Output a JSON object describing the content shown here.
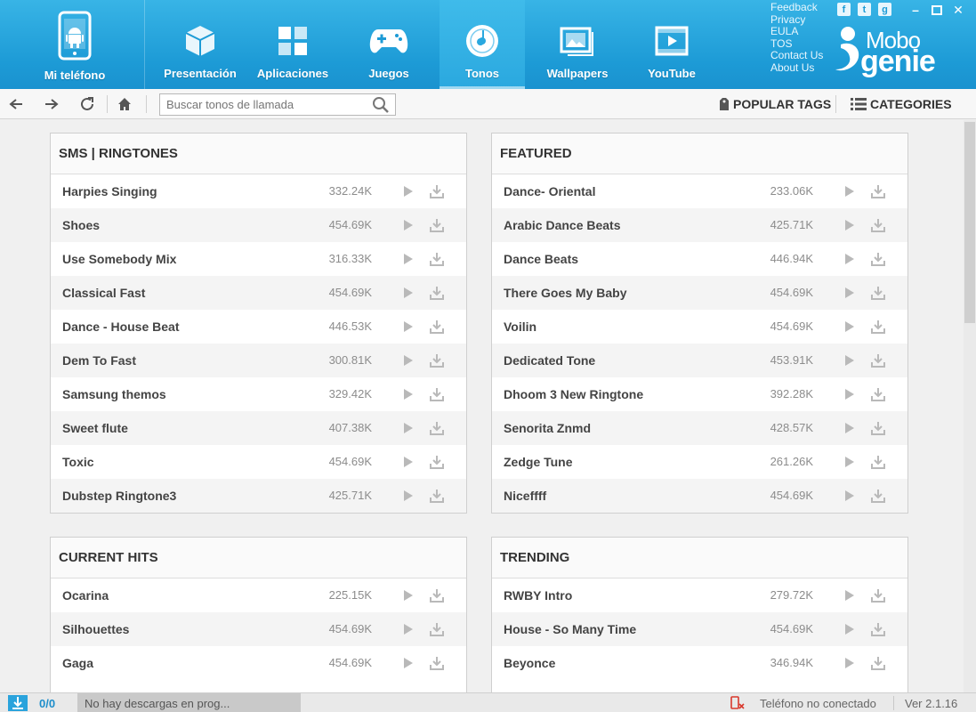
{
  "header": {
    "nav": [
      {
        "id": "mi-telefono",
        "label": "Mi teléfono",
        "icon": "android-phone-icon"
      },
      {
        "id": "presentacion",
        "label": "Presentación",
        "icon": "cube-icon"
      },
      {
        "id": "aplicaciones",
        "label": "Aplicaciones",
        "icon": "apps-grid-icon"
      },
      {
        "id": "juegos",
        "label": "Juegos",
        "icon": "gamepad-icon"
      },
      {
        "id": "tonos",
        "label": "Tonos",
        "icon": "music-disc-icon",
        "active": true
      },
      {
        "id": "wallpapers",
        "label": "Wallpapers",
        "icon": "picture-icon"
      },
      {
        "id": "youtube",
        "label": "YouTube",
        "icon": "video-play-icon"
      }
    ],
    "links": [
      "Feedback",
      "Privacy",
      "EULA",
      "TOS",
      "Contact Us",
      "About Us"
    ],
    "logo_line1": "Mobo",
    "logo_line2": "genie"
  },
  "toolbar": {
    "search_placeholder": "Buscar tonos de llamada",
    "popular_tags": "POPULAR TAGS",
    "categories": "CATEGORIES"
  },
  "panels": [
    {
      "title": "SMS | RINGTONES",
      "items": [
        {
          "name": "Harpies Singing",
          "size": "332.24K"
        },
        {
          "name": "Shoes",
          "size": "454.69K"
        },
        {
          "name": "Use Somebody Mix",
          "size": "316.33K"
        },
        {
          "name": "Classical Fast",
          "size": "454.69K"
        },
        {
          "name": "Dance - House Beat",
          "size": "446.53K"
        },
        {
          "name": "Dem To Fast",
          "size": "300.81K"
        },
        {
          "name": "Samsung themos",
          "size": "329.42K"
        },
        {
          "name": "Sweet flute",
          "size": "407.38K"
        },
        {
          "name": "Toxic",
          "size": "454.69K"
        },
        {
          "name": "Dubstep Ringtone3",
          "size": "425.71K"
        }
      ]
    },
    {
      "title": "FEATURED",
      "items": [
        {
          "name": "Dance- Oriental",
          "size": "233.06K"
        },
        {
          "name": "Arabic Dance Beats",
          "size": "425.71K"
        },
        {
          "name": "Dance Beats",
          "size": "446.94K"
        },
        {
          "name": "There Goes My Baby",
          "size": "454.69K"
        },
        {
          "name": "Voilin",
          "size": "454.69K"
        },
        {
          "name": "Dedicated Tone",
          "size": "453.91K"
        },
        {
          "name": "Dhoom 3 New Ringtone",
          "size": "392.28K"
        },
        {
          "name": "Senorita Znmd",
          "size": "428.57K"
        },
        {
          "name": "Zedge Tune",
          "size": "261.26K"
        },
        {
          "name": "Niceffff",
          "size": "454.69K"
        }
      ]
    },
    {
      "title": "CURRENT HITS",
      "items": [
        {
          "name": "Ocarina",
          "size": "225.15K"
        },
        {
          "name": "Silhouettes",
          "size": "454.69K"
        },
        {
          "name": "Gaga",
          "size": "454.69K"
        }
      ]
    },
    {
      "title": "TRENDING",
      "items": [
        {
          "name": "RWBY Intro",
          "size": "279.72K"
        },
        {
          "name": "House - So Many Time",
          "size": "454.69K"
        },
        {
          "name": "Beyonce",
          "size": "346.94K"
        }
      ]
    }
  ],
  "status": {
    "count": "0/0",
    "message": "No hay descargas en prog...",
    "connection": "Teléfono no conectado",
    "version": "Ver 2.1.16"
  }
}
